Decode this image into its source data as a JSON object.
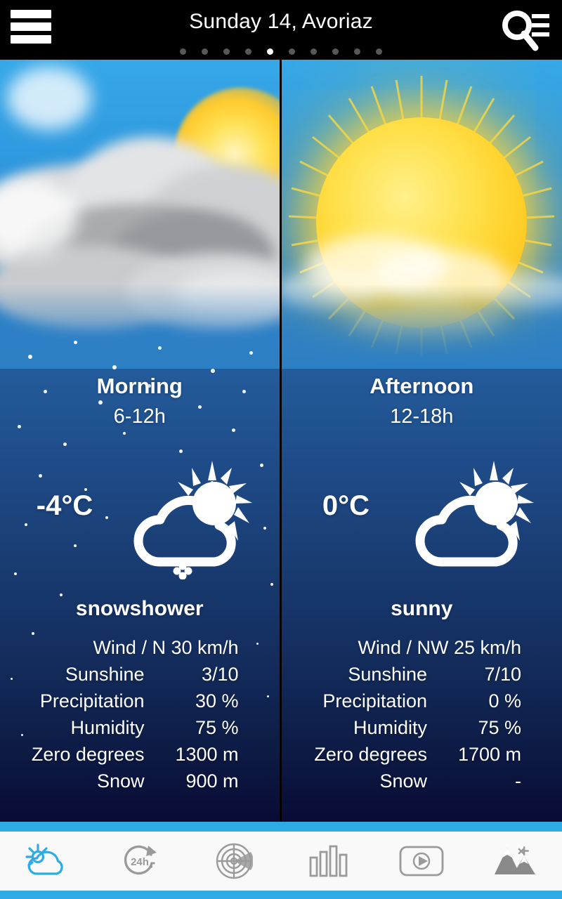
{
  "header": {
    "title": "Sunday 14, Avoriaz",
    "menu_icon": "hamburger-menu-icon",
    "search_icon": "search-list-icon",
    "pager": {
      "total": 10,
      "active_index": 4
    }
  },
  "panels": [
    {
      "period": "Morning",
      "hours": "6-12h",
      "temperature": "-4°C",
      "condition": "snowshower",
      "icon": "sun-behind-cloud-snow-icon",
      "scene": "snow-cloud-photo",
      "rows": [
        {
          "label": "Wind / N 30 km/h",
          "value": "",
          "wide": true
        },
        {
          "label": "Sunshine",
          "value": "3/10"
        },
        {
          "label": "Precipitation",
          "value": "30 %"
        },
        {
          "label": "Humidity",
          "value": "75 %"
        },
        {
          "label": "Zero degrees",
          "value": "1300 m"
        },
        {
          "label": "Snow",
          "value": "900 m"
        }
      ]
    },
    {
      "period": "Afternoon",
      "hours": "12-18h",
      "temperature": "0°C",
      "condition": "sunny",
      "icon": "sun-behind-cloud-icon",
      "scene": "bright-sun-photo",
      "rows": [
        {
          "label": "Wind / NW 25 km/h",
          "value": "",
          "wide": true
        },
        {
          "label": "Sunshine",
          "value": "7/10"
        },
        {
          "label": "Precipitation",
          "value": "0 %"
        },
        {
          "label": "Humidity",
          "value": "75 %"
        },
        {
          "label": "Zero degrees",
          "value": "1700 m"
        },
        {
          "label": "Snow",
          "value": "-"
        }
      ]
    }
  ],
  "bottom_nav": [
    {
      "name": "forecast",
      "icon": "sun-cloud-icon",
      "active": true
    },
    {
      "name": "hourly",
      "icon": "24h-refresh-icon",
      "active": false
    },
    {
      "name": "radar",
      "icon": "radar-icon",
      "active": false
    },
    {
      "name": "stats",
      "icon": "bar-chart-icon",
      "active": false
    },
    {
      "name": "video",
      "icon": "video-play-icon",
      "active": false
    },
    {
      "name": "mountains",
      "icon": "snow-mountains-icon",
      "active": false
    }
  ],
  "colors": {
    "accent_cyan": "#2dabe3",
    "header_bg": "#000000",
    "sky_blue": "#36a8e8",
    "deep_navy": "#090b35",
    "nav_bg": "#f9f9f9",
    "nav_inactive": "#9a9a9a"
  }
}
